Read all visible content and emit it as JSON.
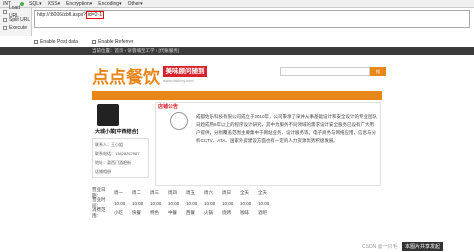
{
  "hackbar": {
    "left_label": "INT",
    "tabs": [
      "SQL▾",
      "XSS▾",
      "Encryption▾",
      "Encoding▾",
      "Other▾"
    ],
    "side_items": [
      "Load URL",
      "Split URL",
      "Execute"
    ],
    "url_prefix": "http://",
    "url_host": ":8006/zbfl.aspx?",
    "url_highlight": "id=2-1",
    "opt_post": "Enable Post data",
    "opt_referrer": "Enable Referrer"
  },
  "site": {
    "topnav": "当前位置：首页 › 诉蓉埔至工学 › [代账服务]",
    "logo_main": "点点餐饮",
    "logo_badge": "美味顾问随到",
    "logo_url": "www.dddccy.com",
    "search_btn": "搜",
    "card_name": "大城小菜[中西结合]",
    "card_lines": [
      "联系人：王小姐",
      "联系电话：13628267987",
      "地址：渤西门酒吧街",
      "店铺相册"
    ],
    "ad_title": "店铺公告",
    "ad_text": "成都佐乐科技有限公司成立于2010年，公司秉承了泉并从事基础设计和安全设计的专业团队日趋成熟5年以上的程序设计研究，其中为服务不同领域的需求设计安全服务已设有广大用户提供，分别覆盖范围主要集中于网站业务、设计服务等。电子商务与网络应用，信息与分析CCTV、ATA、国家外资建设方面也有一定的人力资源优势积极发展。"
  },
  "table": {
    "rows": [
      [
        "营业日期：",
        "周一",
        "周二",
        "周三",
        "周四",
        "周五",
        "周六",
        "周日",
        "全天",
        "全天"
      ],
      [
        "营业时间：",
        "10:00",
        "10:00",
        "10:00",
        "10:00",
        "10:00",
        "10:00",
        "10:00",
        "10:00",
        "10:00"
      ],
      [
        "消费范围：",
        "小吃",
        "快餐",
        "特色",
        "中餐",
        "西餐",
        "火锅",
        "烧烤",
        "咖啡",
        "酒吧"
      ]
    ]
  },
  "footer": {
    "csdn": "CSDN @一只毛",
    "badge": "本图片共享发起"
  },
  "colors": {
    "accent": "#e8861a",
    "brand_red": "#d8222b"
  }
}
